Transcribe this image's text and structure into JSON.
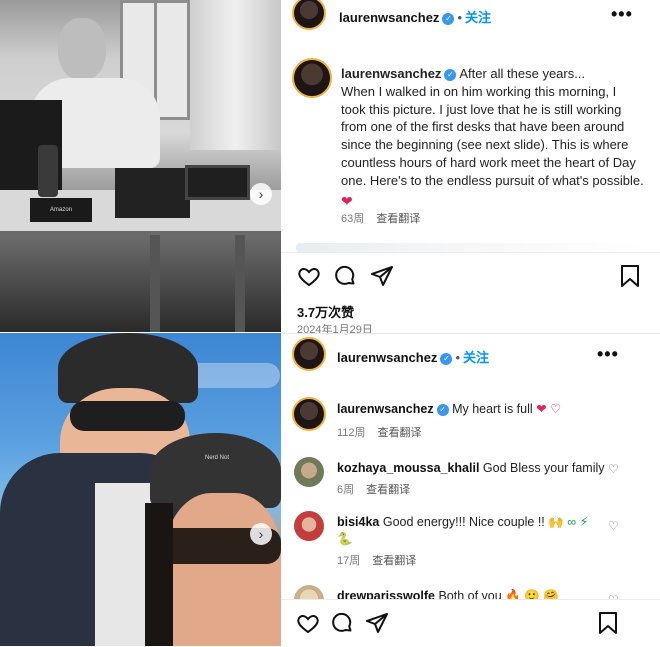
{
  "post1": {
    "username": "laurenwsanchez",
    "follow": "关注",
    "more": "•••",
    "caption_lines": [
      "After all these years...",
      "When I walked in on him working this morning, I",
      "took this picture. I just love that he is still working",
      "from one of the first desks that have been around",
      "since the beginning (see next slide). This is where",
      "countless hours of hard work meet the heart of Day",
      "one. Here's to the endless pursuit of what's possible."
    ],
    "caption_emoji": "❤",
    "age": "63周",
    "translate": "查看翻译"
  },
  "actions": {
    "likes": "3.7万次赞",
    "date": "2024年1月29日"
  },
  "post2": {
    "username": "laurenwsanchez",
    "follow": "关注",
    "more": "•••",
    "caption": "My heart is full",
    "caption_emoji": "❤ ♡",
    "age": "112周",
    "translate": "查看翻译"
  },
  "comments": [
    {
      "user": "kozhaya_moussa_khalil",
      "text": "God Bless your family",
      "age": "6周",
      "translate": "查看翻译"
    },
    {
      "user": "bisi4ka",
      "text": "Good energy!!! Nice couple !!",
      "emoji": "🙌 ∞ ⚡ 🐍",
      "age": "17周",
      "translate": "查看翻译"
    },
    {
      "user": "drewparisswolfe",
      "text": "Both of you",
      "emoji": "🔥 🙂 🤗"
    }
  ],
  "photo_marks": {
    "desk_sign": "Amazon",
    "cap_text": "Nerd Not"
  },
  "colors": {
    "accent": "#0095f6",
    "verified": "#3897f0",
    "heart": "#e0245e"
  }
}
